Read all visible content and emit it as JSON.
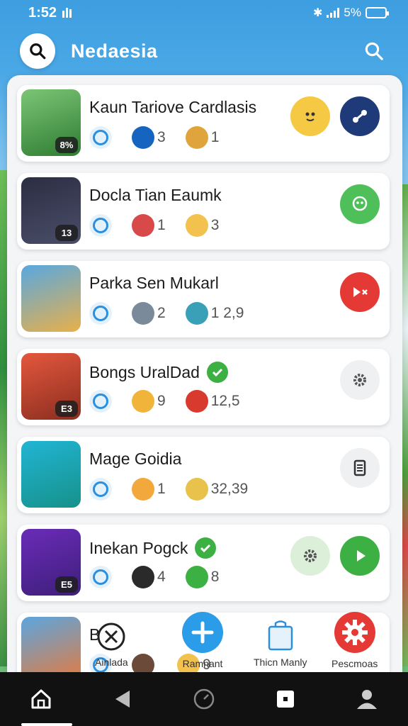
{
  "status": {
    "time": "1:52",
    "battery": "5%",
    "battery_level": 0.8
  },
  "header": {
    "title": "Nedaesia"
  },
  "items": [
    {
      "title": "Kaun Tariove Cardlasis",
      "badge": "8%",
      "verified": false,
      "stat1": "3",
      "stat2": "1",
      "thumb_colors": [
        "#7cc576",
        "#2e7d32"
      ],
      "stat1_color": "#1565c0",
      "stat2_color": "#e0a43c",
      "actions": [
        {
          "name": "emoji-face-icon",
          "bg": "#f6c944"
        },
        {
          "name": "share-icon",
          "bg": "#1e3a78"
        }
      ]
    },
    {
      "title": "Docla Tian Eaumk",
      "badge": "13",
      "verified": false,
      "stat1": "1",
      "stat2": "3",
      "thumb_colors": [
        "#2b2d42",
        "#4a4e69"
      ],
      "stat1_color": "#d84a4a",
      "stat2_color": "#f2c14e",
      "actions": [
        {
          "name": "face-icon",
          "bg": "#4fbf5a"
        }
      ]
    },
    {
      "title": "Parka Sen Mukarl",
      "badge": "",
      "verified": false,
      "stat1": "2",
      "stat2": "1 2,9",
      "thumb_colors": [
        "#58a8e0",
        "#e8b04a"
      ],
      "stat1_color": "#7a8a9a",
      "stat2_color": "#3aa0b8",
      "actions": [
        {
          "name": "video-close-icon",
          "bg": "#e53935"
        }
      ]
    },
    {
      "title": "Bongs UralDad",
      "badge": "E3",
      "verified": true,
      "stat1": "9",
      "stat2": "12,5",
      "thumb_colors": [
        "#e4573d",
        "#8b2e1f"
      ],
      "stat1_color": "#f0b43a",
      "stat2_color": "#d93a2e",
      "actions": [
        {
          "name": "gear-icon",
          "bg": "#eef0f2"
        }
      ]
    },
    {
      "title": "Mage Goidia",
      "badge": "",
      "verified": false,
      "stat1": "1",
      "stat2": "32,39",
      "thumb_colors": [
        "#21b5d4",
        "#16918a"
      ],
      "stat1_color": "#f2a83a",
      "stat2_color": "#e8c24a",
      "actions": [
        {
          "name": "document-icon",
          "bg": "#eef0f2"
        }
      ]
    },
    {
      "title": "Inekan Pogck",
      "badge": "E5",
      "verified": true,
      "stat1": "4",
      "stat2": "8",
      "thumb_colors": [
        "#6a2bb8",
        "#3e1f7a"
      ],
      "stat1_color": "#2a2a2a",
      "stat2_color": "#3cb043",
      "actions": [
        {
          "name": "gear-icon",
          "bg": "#dcefd9"
        },
        {
          "name": "play-icon",
          "bg": "#3cb043"
        }
      ]
    },
    {
      "title": "Bt",
      "badge": "",
      "verified": false,
      "stat1": "",
      "stat2": "9",
      "thumb_colors": [
        "#5aa6e0",
        "#e87a3a"
      ],
      "stat1_color": "#6b4a3a",
      "stat2_color": "#f2c14e",
      "actions": []
    }
  ],
  "float_actions": [
    {
      "label": "Ainlada",
      "icon": "close-circle-icon"
    },
    {
      "label": "Ramnant",
      "icon": "plus-icon"
    },
    {
      "label": "Thicn Manly",
      "icon": "bag-icon"
    },
    {
      "label": "Pescmoas",
      "icon": "gear-icon"
    }
  ],
  "colors": {
    "accent_blue": "#2b8fe0",
    "header_bg": "#3d9ee0",
    "green": "#3cb043",
    "red": "#e53935"
  }
}
